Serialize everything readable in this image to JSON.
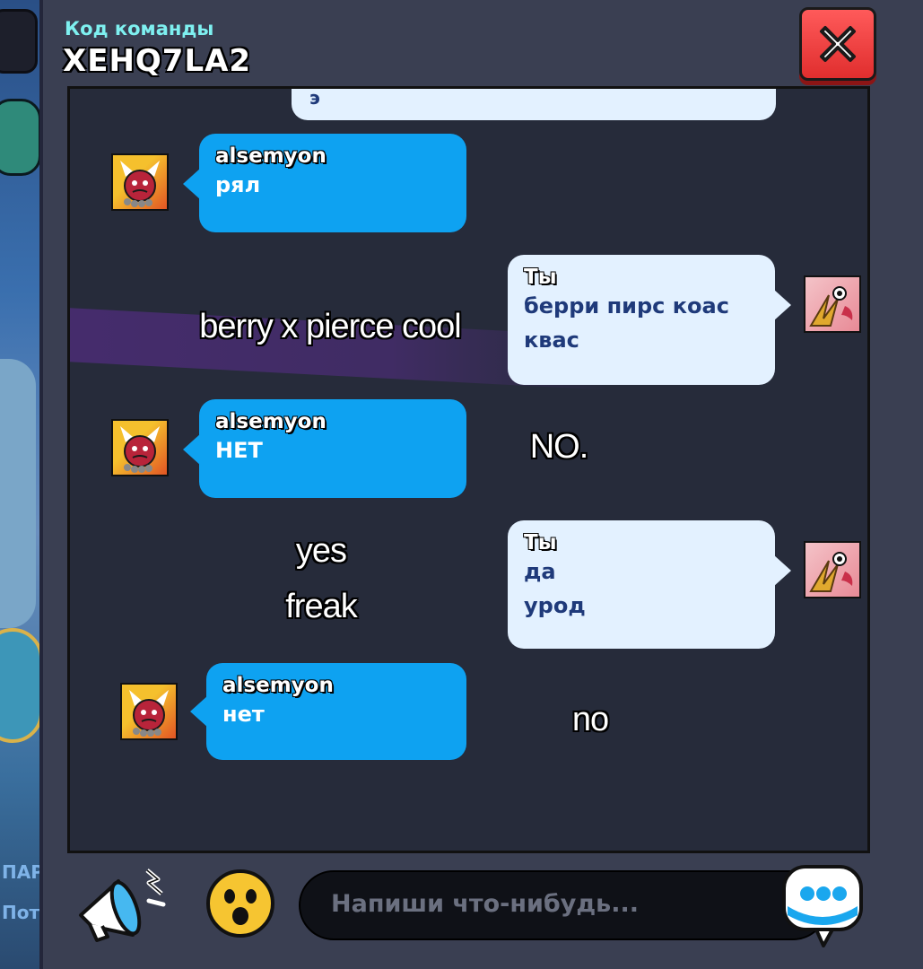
{
  "header": {
    "team_label": "Код команды",
    "team_code": "XEHQ7LA2"
  },
  "messages": [
    {
      "side": "left",
      "name": "alsemyon",
      "text": "рял"
    },
    {
      "side": "right",
      "name": "Ты",
      "lines": [
        "берри пирс коас",
        "квас"
      ]
    },
    {
      "side": "left",
      "name": "alsemyon",
      "text": "НЕТ"
    },
    {
      "side": "right",
      "name": "Ты",
      "lines": [
        "да",
        "урод"
      ]
    },
    {
      "side": "left",
      "name": "alsemyon",
      "text": "нет"
    }
  ],
  "cut_message_text": "э",
  "overlay_captions": [
    "berry x pierce cool",
    "NO.",
    "yes",
    "freak",
    "no"
  ],
  "background_texts": [
    "ПАР",
    "Пот"
  ],
  "input": {
    "placeholder": "Напиши что-нибудь..."
  },
  "colors": {
    "bubble_other": "#0ea2f1",
    "bubble_self": "#e3f1ff",
    "close_button": "#e83434",
    "panel": "#262b3a"
  },
  "icons": {
    "close": "close-x-icon",
    "megaphone": "megaphone-icon",
    "emoji": "emoji-icon",
    "send": "chat-bubble-icon"
  }
}
